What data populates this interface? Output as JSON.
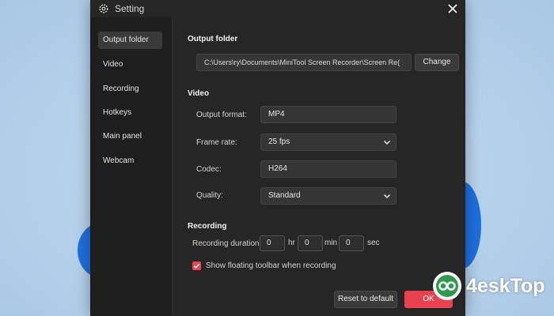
{
  "window": {
    "title": "Setting",
    "title_icon": "gear-icon",
    "close_icon": "close-icon"
  },
  "sidebar": {
    "items": [
      {
        "label": "Output folder",
        "active": true
      },
      {
        "label": "Video",
        "active": false
      },
      {
        "label": "Recording",
        "active": false
      },
      {
        "label": "Hotkeys",
        "active": false
      },
      {
        "label": "Main panel",
        "active": false
      },
      {
        "label": "Webcam",
        "active": false
      }
    ]
  },
  "output_folder": {
    "heading": "Output folder",
    "path": "C:\\Users\\ry\\Documents\\MiniTool Screen Recorder\\Screen Re(",
    "change_label": "Change"
  },
  "video": {
    "heading": "Video",
    "output_format_label": "Output format:",
    "output_format_value": "MP4",
    "frame_rate_label": "Frame rate:",
    "frame_rate_value": "25 fps",
    "codec_label": "Codec:",
    "codec_value": "H264",
    "quality_label": "Quality:",
    "quality_value": "Standard"
  },
  "recording": {
    "heading": "Recording",
    "duration_label": "Recording duration",
    "hours": "0",
    "hr_unit": "hr",
    "minutes": "0",
    "min_unit": "min",
    "seconds": "0",
    "sec_unit": "sec",
    "floating_toolbar_label": "Show floating toolbar when recording",
    "floating_toolbar_checked": true
  },
  "footer": {
    "reset_label": "Reset to default",
    "ok_label": "OK"
  },
  "watermark": {
    "text": "4eskTop"
  },
  "colors": {
    "accent": "#e8414f",
    "window_bg": "#262626",
    "sidebar_bg": "#1e1e1e"
  }
}
